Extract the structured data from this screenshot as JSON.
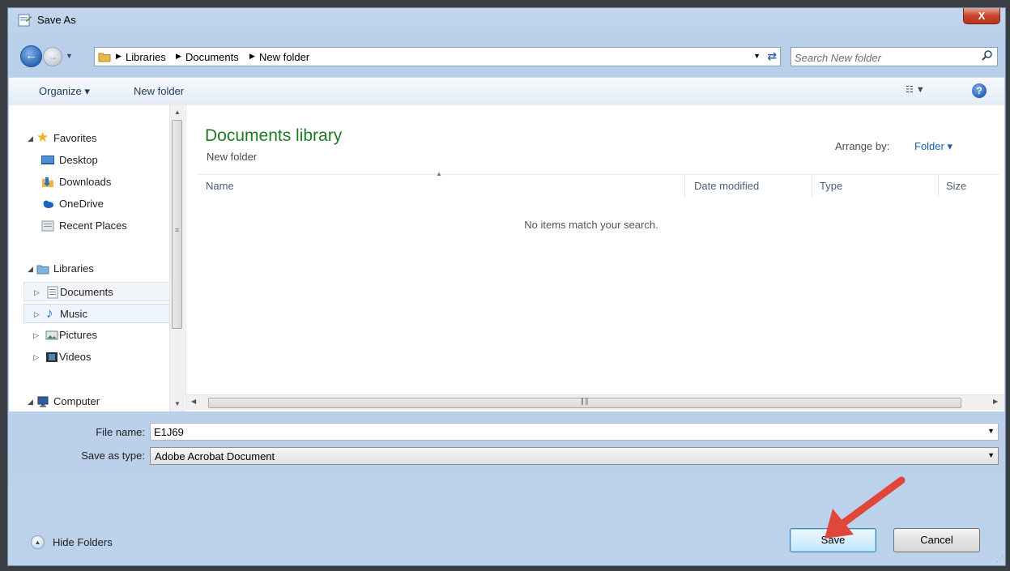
{
  "window": {
    "title": "Save As",
    "close_label": "X"
  },
  "address_bar": {
    "segments": [
      "Libraries",
      "Documents",
      "New folder"
    ]
  },
  "search": {
    "placeholder": "Search New folder"
  },
  "toolbar": {
    "organize_label": "Organize ▾",
    "new_folder_label": "New folder"
  },
  "nav_pane": {
    "favorites": {
      "label": "Favorites",
      "items": [
        "Desktop",
        "Downloads",
        "OneDrive",
        "Recent Places"
      ]
    },
    "libraries": {
      "label": "Libraries",
      "items": [
        "Documents",
        "Music",
        "Pictures",
        "Videos"
      ]
    },
    "computer": {
      "label": "Computer"
    }
  },
  "content": {
    "title": "Documents library",
    "subtitle": "New folder",
    "arrange_by_label": "Arrange by:",
    "arrange_by_value": "Folder ▾",
    "columns": [
      "Name",
      "Date modified",
      "Type",
      "Size"
    ],
    "empty_message": "No items match your search."
  },
  "form": {
    "file_name_label": "File name:",
    "file_name_value": "E1J69",
    "save_as_type_label": "Save as type:",
    "save_as_type_value": "Adobe Acrobat Document"
  },
  "buttons": {
    "hide_folders": "Hide Folders",
    "save": "Save",
    "cancel": "Cancel"
  },
  "colors": {
    "library_title": "#1e7b24",
    "link": "#1c5fb0",
    "annotation_arrow": "#e0463a"
  }
}
